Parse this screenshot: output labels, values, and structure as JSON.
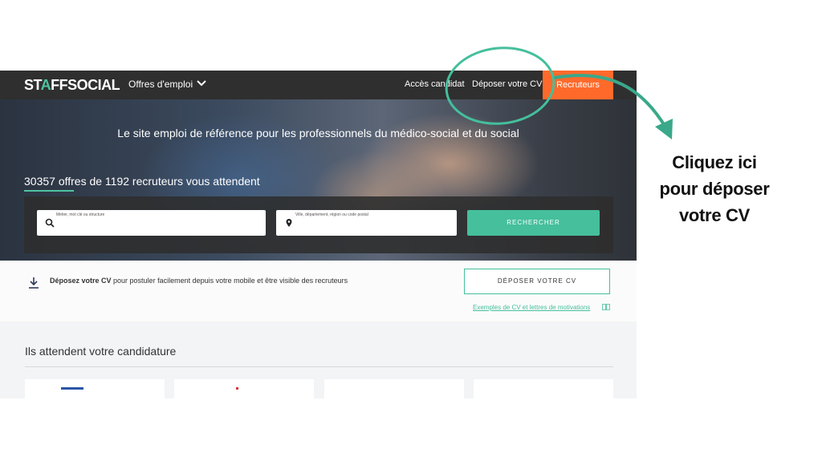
{
  "nav": {
    "logo_start": "ST",
    "logo_accent": "A",
    "logo_end": "FFSOCIAL",
    "offres_label": "Offres d'emploi",
    "acces_candidat": "Accès candidat",
    "deposer_cv": "Déposer votre CV",
    "recruteurs": "Recruteurs"
  },
  "hero": {
    "tagline": "Le site emploi de référence pour les professionnels du médico-social et du social",
    "count_text": "30357 offres de 1192 recruteurs vous attendent"
  },
  "search": {
    "job_label": "Métier, mot clé ou structure",
    "location_label": "Ville, département, région ou code postal",
    "button_label": "RECHERCHER"
  },
  "deposit": {
    "bold_text": "Déposez votre CV",
    "rest_text": " pour postuler facilement depuis votre mobile et être visible des recruteurs",
    "button_label": "DÉPOSER VOTRE CV",
    "examples_link": "Exemples de CV et lettres de motivations"
  },
  "section": {
    "title": "Ils attendent votre candidature"
  },
  "annotation": {
    "line1": "Cliquez ici",
    "line2": "pour déposer",
    "line3": "votre CV"
  },
  "icons": {
    "chevron": "chevron-down-icon",
    "search": "search-icon",
    "location": "location-pin-icon",
    "download": "download-icon",
    "book": "book-icon"
  },
  "colors": {
    "accent": "#45bf9c",
    "recruteurs_bg": "#ff6a2b",
    "nav_bg": "#2f2f2f"
  }
}
